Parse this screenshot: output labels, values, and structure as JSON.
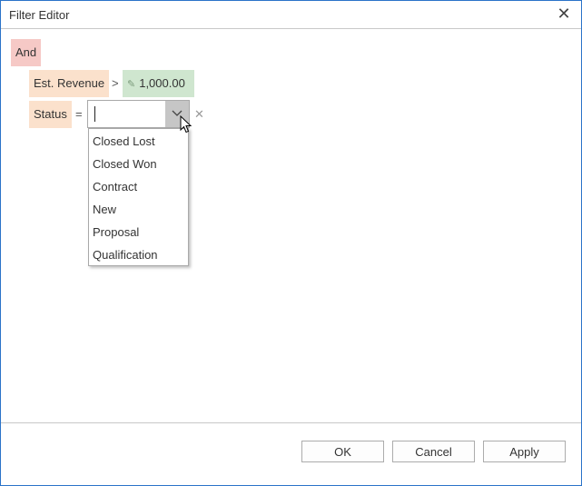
{
  "window": {
    "title": "Filter Editor"
  },
  "filter": {
    "group_operator": "And",
    "conditions": [
      {
        "field": "Est. Revenue",
        "operator": ">",
        "value": "1,000.00"
      },
      {
        "field": "Status",
        "operator": "=",
        "value": ""
      }
    ]
  },
  "dropdown": {
    "options": [
      "Closed Lost",
      "Closed Won",
      "Contract",
      "New",
      "Proposal",
      "Qualification"
    ]
  },
  "footer": {
    "ok_label": "OK",
    "cancel_label": "Cancel",
    "apply_label": "Apply"
  },
  "icons": {
    "close": "close-icon",
    "pencil": "pencil-icon",
    "chevron": "chevron-down-icon",
    "remove": "remove-condition-icon",
    "pointer": "mouse-pointer-icon"
  },
  "colors": {
    "group_chip": "#f6c9c6",
    "field_chip": "#fbe1cc",
    "value_chip": "#cfe6cf",
    "window_border": "#2b73c9"
  }
}
